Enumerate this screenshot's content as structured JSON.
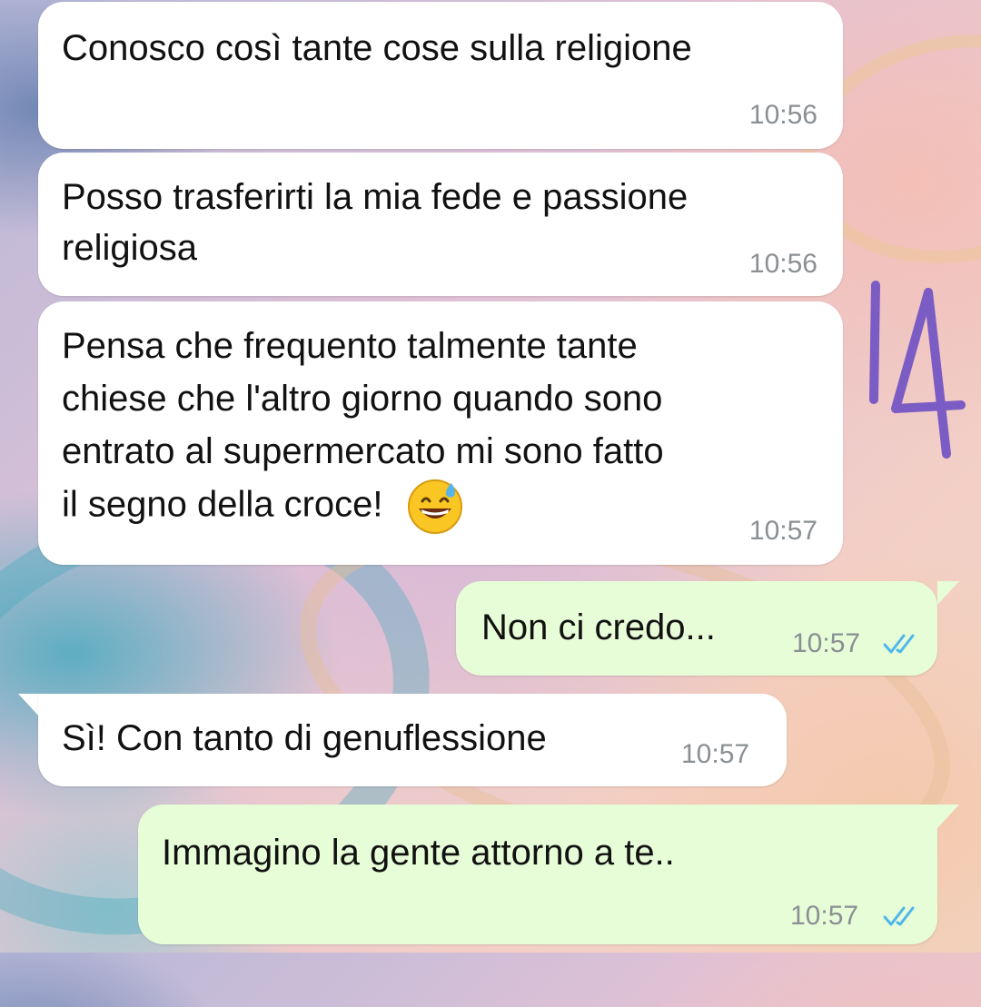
{
  "messages": [
    {
      "direction": "incoming",
      "text": "Conosco così tante cose sulla religione",
      "time": "10:56"
    },
    {
      "direction": "incoming",
      "text_line1": "Posso trasferirti la mia fede e passione",
      "text_line2": "religiosa",
      "time": "10:56"
    },
    {
      "direction": "incoming",
      "lines": [
        "Pensa che frequento talmente tante",
        "chiese che l'altro giorno quando sono",
        "entrato al supermercato mi sono fatto",
        "il segno della croce!"
      ],
      "emoji": "grinning-face-with-sweat",
      "time": "10:57"
    },
    {
      "direction": "outgoing",
      "text": "Non ci credo...",
      "time": "10:57",
      "status": "read"
    },
    {
      "direction": "incoming",
      "text": "Sì! Con tanto di genuflessione",
      "time": "10:57"
    },
    {
      "direction": "outgoing",
      "text": "Immagino la gente attorno a te..",
      "time": "10:57",
      "status": "read"
    }
  ],
  "annotation": {
    "text": "14",
    "color": "#7b5cc4"
  },
  "colors": {
    "incoming_bubble": "#ffffff",
    "outgoing_bubble": "#e7fdd8",
    "read_ticks": "#4fb6ec",
    "timestamp": "#8a8f93"
  }
}
